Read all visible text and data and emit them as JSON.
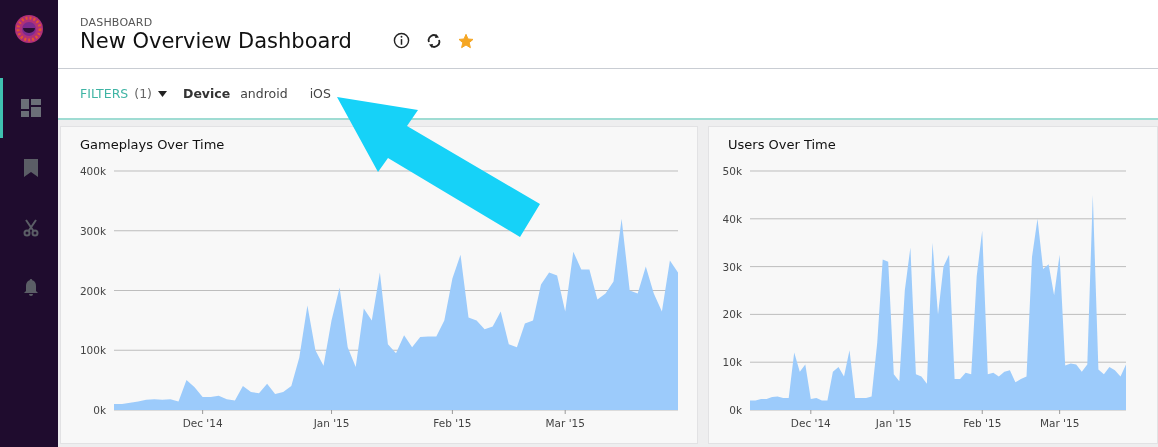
{
  "sidebar": {
    "items": [
      {
        "kind": "dashboard",
        "selected": true
      },
      {
        "kind": "bookmark",
        "selected": false
      },
      {
        "kind": "scissors",
        "selected": false
      },
      {
        "kind": "bell",
        "selected": false
      }
    ]
  },
  "header": {
    "breadcrumb": "DASHBOARD",
    "title": "New Overview Dashboard",
    "starred": true
  },
  "filters": {
    "label": "FILTERS",
    "count": "(1)",
    "expanded": false,
    "field": "Device",
    "values": [
      "android",
      "iOS"
    ]
  },
  "panels": [
    {
      "title": "Gameplays Over Time",
      "chart_data": {
        "type": "area",
        "grid": true,
        "ylim": [
          0,
          400
        ],
        "yticks": [
          {
            "value": 0,
            "label": "0k"
          },
          {
            "value": 100,
            "label": "100k"
          },
          {
            "value": 200,
            "label": "200k"
          },
          {
            "value": 300,
            "label": "300k"
          },
          {
            "value": 400,
            "label": "400k"
          }
        ],
        "categories": [
          null,
          null,
          null,
          null,
          null,
          null,
          null,
          null,
          null,
          null,
          null,
          "Dec '14",
          null,
          null,
          null,
          null,
          null,
          null,
          null,
          null,
          null,
          null,
          null,
          null,
          null,
          null,
          null,
          "Jan '15",
          null,
          null,
          null,
          null,
          null,
          null,
          null,
          null,
          null,
          null,
          null,
          null,
          null,
          null,
          "Feb '15",
          null,
          null,
          null,
          null,
          null,
          null,
          null,
          null,
          null,
          null,
          null,
          null,
          null,
          "Mar '15",
          null,
          null,
          null,
          null,
          null,
          null,
          null,
          null,
          null,
          null,
          null,
          null,
          null,
          null
        ],
        "series": [
          {
            "color": "#9ccbfb",
            "values": [
              10,
              10,
              12,
              14,
              17,
              18,
              17,
              18,
              14,
              50,
              38,
              22,
              22,
              24,
              18,
              16,
              40,
              30,
              28,
              44,
              27,
              30,
              40,
              88,
              175,
              100,
              74,
              150,
              205,
              105,
              72,
              170,
              150,
              230,
              110,
              95,
              125,
              105,
              122,
              123,
              123,
              150,
              220,
              260,
              155,
              150,
              135,
              140,
              165,
              110,
              105,
              145,
              150,
              210,
              230,
              225,
              165,
              265,
              235,
              235,
              185,
              195,
              215,
              320,
              200,
              195,
              240,
              195,
              165,
              250,
              230
            ]
          }
        ]
      }
    },
    {
      "title": "Users Over Time",
      "chart_data": {
        "type": "area",
        "grid": true,
        "ylim": [
          0,
          50
        ],
        "yticks": [
          {
            "value": 0,
            "label": "0k"
          },
          {
            "value": 10,
            "label": "10k"
          },
          {
            "value": 20,
            "label": "20k"
          },
          {
            "value": 30,
            "label": "30k"
          },
          {
            "value": 40,
            "label": "40k"
          },
          {
            "value": 50,
            "label": "50k"
          }
        ],
        "categories": [
          null,
          null,
          null,
          null,
          null,
          null,
          null,
          null,
          null,
          null,
          null,
          "Dec '14",
          null,
          null,
          null,
          null,
          null,
          null,
          null,
          null,
          null,
          null,
          null,
          null,
          null,
          null,
          "Jan '15",
          null,
          null,
          null,
          null,
          null,
          null,
          null,
          null,
          null,
          null,
          null,
          null,
          null,
          null,
          null,
          "Feb '15",
          null,
          null,
          null,
          null,
          null,
          null,
          null,
          null,
          null,
          null,
          null,
          null,
          null,
          "Mar '15",
          null,
          null,
          null,
          null,
          null,
          null,
          null,
          null,
          null,
          null,
          null,
          null
        ],
        "series": [
          {
            "color": "#9ccbfb",
            "values": [
              2,
              2,
              2.3,
              2.3,
              2.7,
              2.8,
              2.5,
              2.5,
              12,
              8,
              9.5,
              2.3,
              2.5,
              2,
              2,
              8,
              9,
              7,
              12.5,
              2.5,
              2.5,
              2.5,
              2.8,
              14,
              31.5,
              31,
              7.5,
              6,
              25,
              34,
              7.5,
              7,
              5.5,
              35,
              20,
              30,
              32.5,
              6.5,
              6.5,
              7.8,
              7.5,
              28,
              37.5,
              7.5,
              7.8,
              7,
              8,
              8.3,
              5.8,
              6.5,
              7,
              32,
              40,
              29.5,
              30.5,
              24,
              32.5,
              9.3,
              9.7,
              9.5,
              8,
              9.5,
              45,
              8.5,
              7.5,
              9,
              8.3,
              7,
              9.5
            ]
          }
        ]
      }
    }
  ]
}
